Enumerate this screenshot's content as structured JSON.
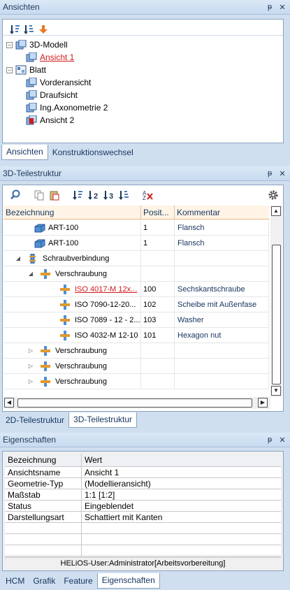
{
  "views_panel": {
    "title": "Ansichten",
    "tree": [
      {
        "label": "3D-Modell"
      },
      {
        "label": "Ansicht 1"
      },
      {
        "label": "Blatt"
      },
      {
        "label": "Vorderansicht"
      },
      {
        "label": "Draufsicht"
      },
      {
        "label": "Ing.Axonometrie 2"
      },
      {
        "label": "Ansicht 2"
      }
    ],
    "tabs": [
      "Ansichten",
      "Konstruktionswechsel"
    ]
  },
  "parts_panel": {
    "title": "3D-Teilestruktur",
    "columns": [
      "Bezeichnung",
      "Posit...",
      "Kommentar"
    ],
    "rows": [
      {
        "name": "ART-100",
        "pos": "1",
        "comment": "Flansch"
      },
      {
        "name": "ART-100",
        "pos": "1",
        "comment": "Flansch"
      },
      {
        "name": "Schraubverbindung",
        "pos": "",
        "comment": ""
      },
      {
        "name": "Verschraubung",
        "pos": "",
        "comment": ""
      },
      {
        "name": "ISO 4017-M 12x...",
        "pos": "100",
        "comment": "Sechskantschraube"
      },
      {
        "name": "ISO 7090-12-20...",
        "pos": "102",
        "comment": "Scheibe mit Außenfase"
      },
      {
        "name": "ISO 7089 - 12 - 2...",
        "pos": "103",
        "comment": "Washer"
      },
      {
        "name": "ISO 4032-M 12-10",
        "pos": "101",
        "comment": "Hexagon nut"
      },
      {
        "name": "Verschraubung",
        "pos": "",
        "comment": ""
      },
      {
        "name": "Verschraubung",
        "pos": "",
        "comment": ""
      },
      {
        "name": "Verschraubung",
        "pos": "",
        "comment": ""
      }
    ],
    "tabs": [
      "2D-Teilestruktur",
      "3D-Teilestruktur"
    ]
  },
  "props_panel": {
    "title": "Eigenschaften",
    "header": {
      "k": "Bezeichnung",
      "v": "Wert"
    },
    "rows": [
      {
        "k": "Ansichtsname",
        "v": "Ansicht 1"
      },
      {
        "k": "Geometrie-Typ",
        "v": "(Modellieransicht)"
      },
      {
        "k": "Maßstab",
        "v": "1:1 [1:2]"
      },
      {
        "k": "Status",
        "v": "Eingeblendet"
      },
      {
        "k": "Darstellungsart",
        "v": "Schattiert mit Kanten"
      }
    ],
    "status": "HELiOS-User:Administrator[Arbeitsvorbereitung]",
    "tabs": [
      "HCM",
      "Grafik",
      "Feature",
      "Eigenschaften"
    ]
  }
}
